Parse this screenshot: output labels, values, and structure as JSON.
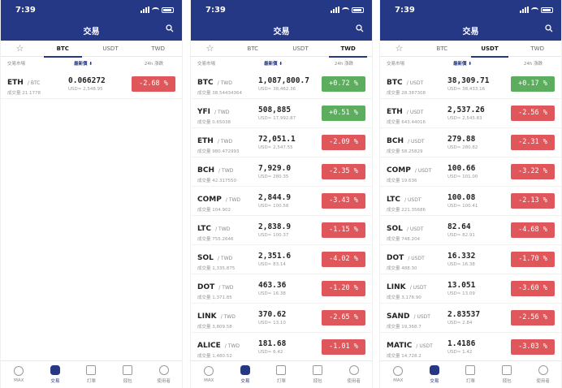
{
  "status_time": "7:39",
  "page_title": "交易",
  "tabs": [
    "BTC",
    "USDT",
    "TWD"
  ],
  "col_headers": {
    "market": "交易市場",
    "latest": "最新價 ⬇",
    "change": "24h 漲跌"
  },
  "nav": [
    "MAX",
    "交易",
    "訂單",
    "錢包",
    "使用者"
  ],
  "colors": {
    "brand": "#243886",
    "down": "#e0575b",
    "up": "#5cae5e"
  },
  "panels": [
    {
      "active_tab": "BTC",
      "rows": [
        {
          "sym": "ETH",
          "pair": "/ BTC",
          "vol": "成交量 21.1778",
          "price": "0.066272",
          "usd": "USD≈ 2,548.95",
          "chg": "-2.68 %",
          "dir": "down"
        }
      ]
    },
    {
      "active_tab": "TWD",
      "rows": [
        {
          "sym": "BTC",
          "pair": "/ TWD",
          "vol": "成交量 38.54434364",
          "price": "1,087,800.7",
          "usd": "USD≈ 38,462.36",
          "chg": "+0.72 %",
          "dir": "up"
        },
        {
          "sym": "YFI",
          "pair": "/ TWD",
          "vol": "成交量 0.65038",
          "price": "508,885",
          "usd": "USD≈ 17,992.87",
          "chg": "+0.51 %",
          "dir": "up"
        },
        {
          "sym": "ETH",
          "pair": "/ TWD",
          "vol": "成交量 980.472993",
          "price": "72,051.1",
          "usd": "USD≈ 2,547.55",
          "chg": "-2.09 %",
          "dir": "down"
        },
        {
          "sym": "BCH",
          "pair": "/ TWD",
          "vol": "成交量 42.317550",
          "price": "7,929.0",
          "usd": "USD≈ 280.35",
          "chg": "-2.35 %",
          "dir": "down"
        },
        {
          "sym": "COMP",
          "pair": "/ TWD",
          "vol": "成交量 104.902",
          "price": "2,844.9",
          "usd": "USD≈ 100.58",
          "chg": "-3.43 %",
          "dir": "down"
        },
        {
          "sym": "LTC",
          "pair": "/ TWD",
          "vol": "成交量 755.2646",
          "price": "2,838.9",
          "usd": "USD≈ 100.37",
          "chg": "-1.15 %",
          "dir": "down"
        },
        {
          "sym": "SOL",
          "pair": "/ TWD",
          "vol": "成交量 1,335.875",
          "price": "2,351.6",
          "usd": "USD≈ 83.14",
          "chg": "-4.02 %",
          "dir": "down"
        },
        {
          "sym": "DOT",
          "pair": "/ TWD",
          "vol": "成交量 1,371.85",
          "price": "463.36",
          "usd": "USD≈ 16.38",
          "chg": "-1.20 %",
          "dir": "down"
        },
        {
          "sym": "LINK",
          "pair": "/ TWD",
          "vol": "成交量 3,809.58",
          "price": "370.62",
          "usd": "USD≈ 13.10",
          "chg": "-2.65 %",
          "dir": "down"
        },
        {
          "sym": "ALICE",
          "pair": "/ TWD",
          "vol": "成交量 1,480.52",
          "price": "181.68",
          "usd": "USD≈ 6.42",
          "chg": "-1.01 %",
          "dir": "down"
        }
      ]
    },
    {
      "active_tab": "USDT",
      "rows": [
        {
          "sym": "BTC",
          "pair": "/ USDT",
          "vol": "成交量 28.387308",
          "price": "38,309.71",
          "usd": "USD≈ 38,433.16",
          "chg": "+0.17 %",
          "dir": "up"
        },
        {
          "sym": "ETH",
          "pair": "/ USDT",
          "vol": "成交量 643.44016",
          "price": "2,537.26",
          "usd": "USD≈ 2,545.83",
          "chg": "-2.56 %",
          "dir": "down"
        },
        {
          "sym": "BCH",
          "pair": "/ USDT",
          "vol": "成交量 58.25829",
          "price": "279.88",
          "usd": "USD≈ 280.82",
          "chg": "-2.31 %",
          "dir": "down"
        },
        {
          "sym": "COMP",
          "pair": "/ USDT",
          "vol": "成交量 19.636",
          "price": "100.66",
          "usd": "USD≈ 101.00",
          "chg": "-3.22 %",
          "dir": "down"
        },
        {
          "sym": "LTC",
          "pair": "/ USDT",
          "vol": "成交量 221.35686",
          "price": "100.08",
          "usd": "USD≈ 100.41",
          "chg": "-2.13 %",
          "dir": "down"
        },
        {
          "sym": "SOL",
          "pair": "/ USDT",
          "vol": "成交量 748.204",
          "price": "82.64",
          "usd": "USD≈ 82.91",
          "chg": "-4.68 %",
          "dir": "down"
        },
        {
          "sym": "DOT",
          "pair": "/ USDT",
          "vol": "成交量 488.30",
          "price": "16.332",
          "usd": "USD≈ 16.38",
          "chg": "-1.70 %",
          "dir": "down"
        },
        {
          "sym": "LINK",
          "pair": "/ USDT",
          "vol": "成交量 3,178.90",
          "price": "13.051",
          "usd": "USD≈ 13.09",
          "chg": "-3.60 %",
          "dir": "down"
        },
        {
          "sym": "SAND",
          "pair": "/ USDT",
          "vol": "成交量 19,368.7",
          "price": "2.83537",
          "usd": "USD≈ 2.84",
          "chg": "-2.56 %",
          "dir": "down"
        },
        {
          "sym": "MATIC",
          "pair": "/ USDT",
          "vol": "成交量 14,728.2",
          "price": "1.4186",
          "usd": "USD≈ 1.42",
          "chg": "-3.03 %",
          "dir": "down"
        }
      ]
    }
  ]
}
